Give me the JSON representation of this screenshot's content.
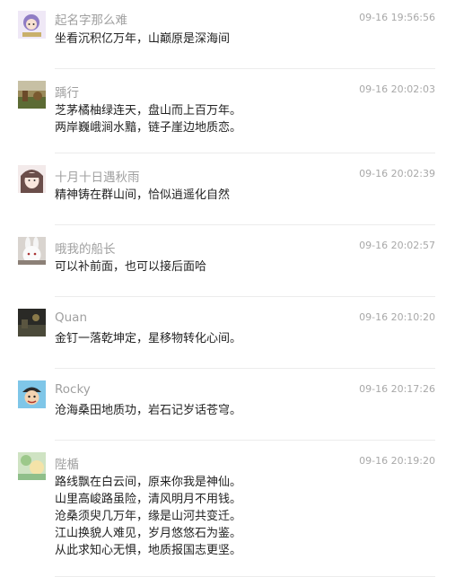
{
  "comments": [
    {
      "user": "起名字那么难",
      "time": "09-16 19:56:56",
      "avatar_icon": "anime-avatar-icon",
      "lines": [
        "坐看沉积亿万年，山巅原是深海间"
      ]
    },
    {
      "user": "踽行",
      "time": "09-16 20:02:03",
      "avatar_icon": "landscape-photo-avatar-icon",
      "lines": [
        "芝茅橘柚绿连天，盘山而上百万年。",
        "两岸巍峨涧水黯，链子崖边地质恋。"
      ]
    },
    {
      "user": "十月十日遇秋雨",
      "time": "09-16 20:02:39",
      "avatar_icon": "anime-girl-avatar-icon",
      "lines": [
        "精神铸在群山间，恰似逍遥化自然"
      ]
    },
    {
      "user": "哦我的船长",
      "time": "09-16 20:02:57",
      "avatar_icon": "rabbit-avatar-icon",
      "lines": [
        "可以补前面，也可以接后面哈"
      ]
    },
    {
      "user": "Quan",
      "time": "09-16 20:10:20",
      "avatar_icon": "dark-scene-avatar-icon",
      "lines": [
        "金钉一落乾坤定，星移物转化心间。"
      ]
    },
    {
      "user": "Rocky",
      "time": "09-16 20:17:26",
      "avatar_icon": "cartoon-pirate-avatar-icon",
      "lines": [
        "沧海桑田地质功，岩石记岁话苍穹。"
      ]
    },
    {
      "user": "陛楯",
      "time": "09-16 20:19:20",
      "avatar_icon": "green-illustration-avatar-icon",
      "lines": [
        "路线飘在白云间，原来你我是神仙。",
        "山里高峻路虽险，清风明月不用钱。",
        "沧桑须臾几万年，缘是山河共变迁。",
        "江山换貌人难见，岁月悠悠石为鉴。",
        "从此求知心无惧，地质报国志更坚。"
      ]
    }
  ]
}
